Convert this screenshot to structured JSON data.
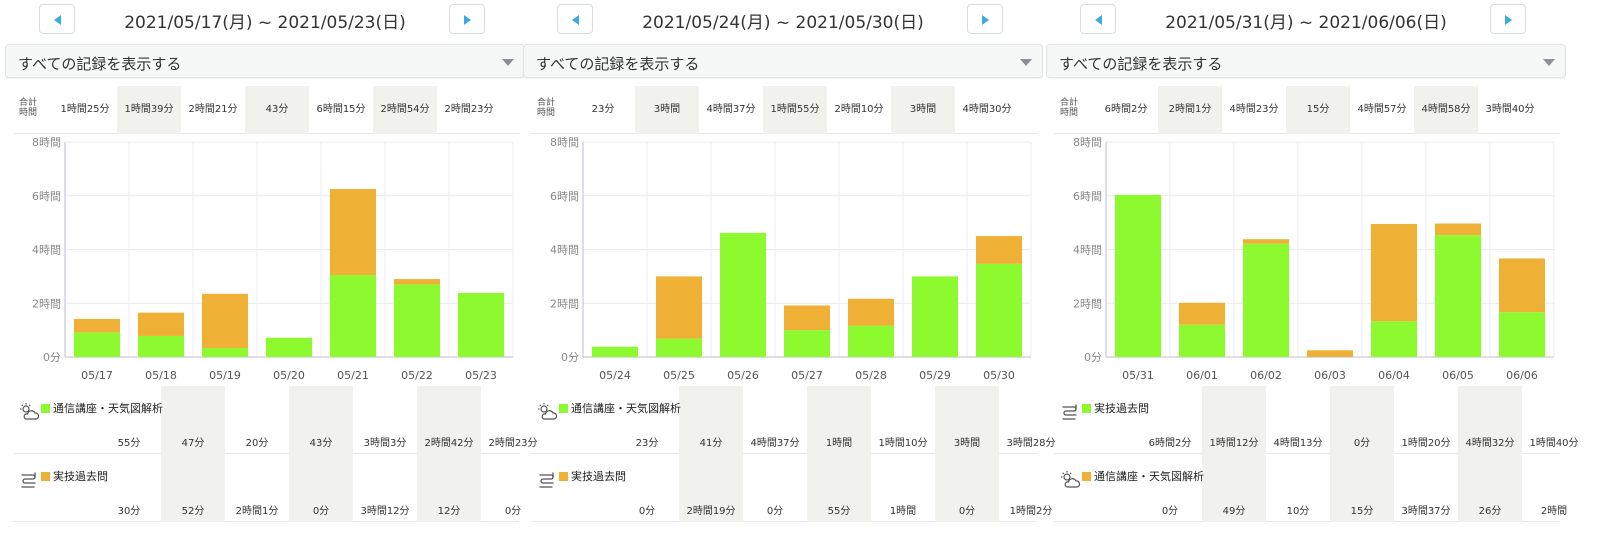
{
  "colors": {
    "green": "#8cfa2e",
    "orange": "#efb036",
    "accent": "#3aa9e4",
    "shade": "#f1f1ed"
  },
  "totals_label": "合計時間",
  "panels": [
    {
      "title": "2021/05/17(月) ~ 2021/05/23(日)",
      "filter": "すべての記録を表示する",
      "totals": [
        "1時間25分",
        "1時間39分",
        "2時間21分",
        "43分",
        "6時間15分",
        "2時間54分",
        "2時間23分"
      ],
      "legend": [
        {
          "name": "通信講座・天気図解析",
          "color": "green",
          "icon": "weather-icon",
          "values": [
            "55分",
            "47分",
            "20分",
            "43分",
            "3時間3分",
            "2時間42分",
            "2時間23分"
          ]
        },
        {
          "name": "実技過去問",
          "color": "orange",
          "icon": "practice-icon",
          "values": [
            "30分",
            "52分",
            "2時間1分",
            "0分",
            "3時間12分",
            "12分",
            "0分"
          ]
        }
      ],
      "chart_data": {
        "type": "bar",
        "stacked": true,
        "categories": [
          "05/17",
          "05/18",
          "05/19",
          "05/20",
          "05/21",
          "05/22",
          "05/23"
        ],
        "ytick_labels": [
          "0分",
          "2時間",
          "4時間",
          "6時間",
          "8時間"
        ],
        "ylim_minutes": [
          0,
          480
        ],
        "series": [
          {
            "name": "通信講座・天気図解析",
            "values": [
              55,
              47,
              20,
              43,
              183,
              162,
              143
            ]
          },
          {
            "name": "実技過去問",
            "values": [
              30,
              52,
              121,
              0,
              192,
              12,
              0
            ]
          }
        ]
      }
    },
    {
      "title": "2021/05/24(月) ~ 2021/05/30(日)",
      "filter": "すべての記録を表示する",
      "totals": [
        "23分",
        "3時間",
        "4時間37分",
        "1時間55分",
        "2時間10分",
        "3時間",
        "4時間30分"
      ],
      "legend": [
        {
          "name": "通信講座・天気図解析",
          "color": "green",
          "icon": "weather-icon",
          "values": [
            "23分",
            "41分",
            "4時間37分",
            "1時間",
            "1時間10分",
            "3時間",
            "3時間28分"
          ]
        },
        {
          "name": "実技過去問",
          "color": "orange",
          "icon": "practice-icon",
          "values": [
            "0分",
            "2時間19分",
            "0分",
            "55分",
            "1時間",
            "0分",
            "1時間2分"
          ]
        }
      ],
      "chart_data": {
        "type": "bar",
        "stacked": true,
        "categories": [
          "05/24",
          "05/25",
          "05/26",
          "05/27",
          "05/28",
          "05/29",
          "05/30"
        ],
        "ytick_labels": [
          "0分",
          "2時間",
          "4時間",
          "6時間",
          "8時間"
        ],
        "ylim_minutes": [
          0,
          480
        ],
        "series": [
          {
            "name": "通信講座・天気図解析",
            "values": [
              23,
              41,
              277,
              60,
              70,
              180,
              208
            ]
          },
          {
            "name": "実技過去問",
            "values": [
              0,
              139,
              0,
              55,
              60,
              0,
              62
            ]
          }
        ]
      }
    },
    {
      "title": "2021/05/31(月) ~ 2021/06/06(日)",
      "filter": "すべての記録を表示する",
      "totals": [
        "6時間2分",
        "2時間1分",
        "4時間23分",
        "15分",
        "4時間57分",
        "4時間58分",
        "3時間40分"
      ],
      "legend": [
        {
          "name": "実技過去問",
          "color": "green",
          "icon": "practice-icon",
          "values": [
            "6時間2分",
            "1時間12分",
            "4時間13分",
            "0分",
            "1時間20分",
            "4時間32分",
            "1時間40分"
          ]
        },
        {
          "name": "通信講座・天気図解析",
          "color": "orange",
          "icon": "weather-icon",
          "values": [
            "0分",
            "49分",
            "10分",
            "15分",
            "3時間37分",
            "26分",
            "2時間"
          ]
        }
      ],
      "chart_data": {
        "type": "bar",
        "stacked": true,
        "categories": [
          "05/31",
          "06/01",
          "06/02",
          "06/03",
          "06/04",
          "06/05",
          "06/06"
        ],
        "ytick_labels": [
          "0分",
          "2時間",
          "4時間",
          "6時間",
          "8時間"
        ],
        "ylim_minutes": [
          0,
          480
        ],
        "series": [
          {
            "name": "実技過去問",
            "values": [
              362,
              72,
              253,
              0,
              80,
              272,
              100
            ]
          },
          {
            "name": "通信講座・天気図解析",
            "values": [
              0,
              49,
              10,
              15,
              217,
              26,
              120
            ]
          }
        ]
      }
    }
  ]
}
